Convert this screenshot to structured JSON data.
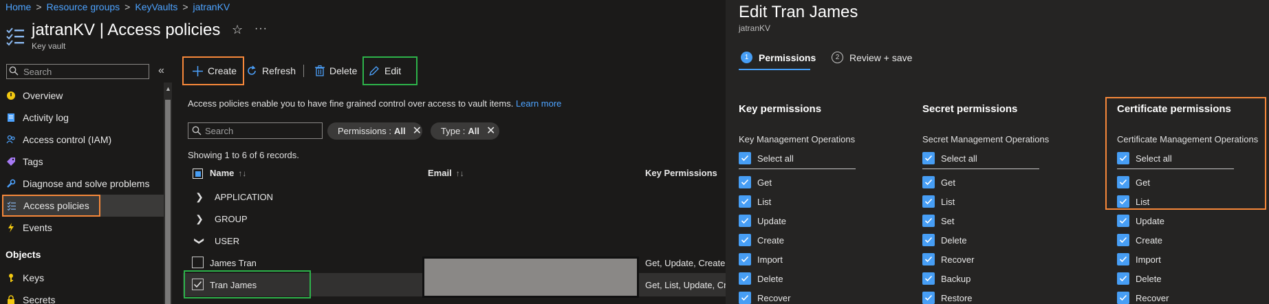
{
  "breadcrumb": [
    "Home",
    "Resource groups",
    "KeyVaults",
    "jatranKV"
  ],
  "breadcrumb_sep": ">",
  "page_title": "jatranKV | Access policies",
  "page_subtitle": "Key vault",
  "star_glyph": "☆",
  "more_glyph": "···",
  "sidebar": {
    "search_placeholder": "Search",
    "collapse_glyph": "«",
    "items": [
      {
        "label": "Overview",
        "icon": "overview-icon"
      },
      {
        "label": "Activity log",
        "icon": "activity-log-icon"
      },
      {
        "label": "Access control (IAM)",
        "icon": "people-icon"
      },
      {
        "label": "Tags",
        "icon": "tag-icon"
      },
      {
        "label": "Diagnose and solve problems",
        "icon": "wrench-icon"
      },
      {
        "label": "Access policies",
        "icon": "policy-list-icon"
      },
      {
        "label": "Events",
        "icon": "lightning-icon"
      }
    ],
    "group_label": "Objects",
    "object_items": [
      {
        "label": "Keys",
        "icon": "key-icon"
      },
      {
        "label": "Secrets",
        "icon": "secret-icon"
      }
    ]
  },
  "toolbar": {
    "create_label": "Create",
    "refresh_label": "Refresh",
    "delete_label": "Delete",
    "edit_label": "Edit"
  },
  "info": {
    "text": "Access policies enable you to have fine grained control over access to vault items.",
    "link": "Learn more"
  },
  "filters": {
    "search_placeholder": "Search",
    "pills": [
      {
        "name": "Permissions :",
        "value": "All"
      },
      {
        "name": "Type :",
        "value": "All"
      }
    ],
    "clear_glyph": "✕"
  },
  "records_text": "Showing 1 to 6 of 6 records.",
  "table": {
    "headers": {
      "name": "Name",
      "email": "Email",
      "keys": "Key Permissions"
    },
    "sort_glyph": "↑↓",
    "groups": [
      "APPLICATION",
      "GROUP",
      "USER"
    ],
    "rows": [
      {
        "name": "James Tran",
        "keys": "Get, Update, Create,",
        "checked": false
      },
      {
        "name": "Tran James",
        "keys": "Get, List, Update, Cr",
        "checked": true
      }
    ]
  },
  "panel": {
    "title": "Edit Tran James",
    "subtitle": "jatranKV",
    "steps": [
      {
        "num": "1",
        "label": "Permissions"
      },
      {
        "num": "2",
        "label": "Review + save"
      }
    ],
    "columns": [
      {
        "title": "Key permissions",
        "subtitle": "Key Management Operations",
        "select_all": "Select all",
        "items": [
          "Get",
          "List",
          "Update",
          "Create",
          "Import",
          "Delete",
          "Recover"
        ]
      },
      {
        "title": "Secret permissions",
        "subtitle": "Secret Management Operations",
        "select_all": "Select all",
        "items": [
          "Get",
          "List",
          "Set",
          "Delete",
          "Recover",
          "Backup",
          "Restore"
        ]
      },
      {
        "title": "Certificate permissions",
        "subtitle": "Certificate Management Operations",
        "select_all": "Select all",
        "items": [
          "Get",
          "List",
          "Update",
          "Create",
          "Import",
          "Delete",
          "Recover"
        ]
      }
    ]
  },
  "colors": {
    "accent": "#479ef5",
    "highlight_orange": "#f7883a",
    "highlight_green": "#2db34a"
  }
}
